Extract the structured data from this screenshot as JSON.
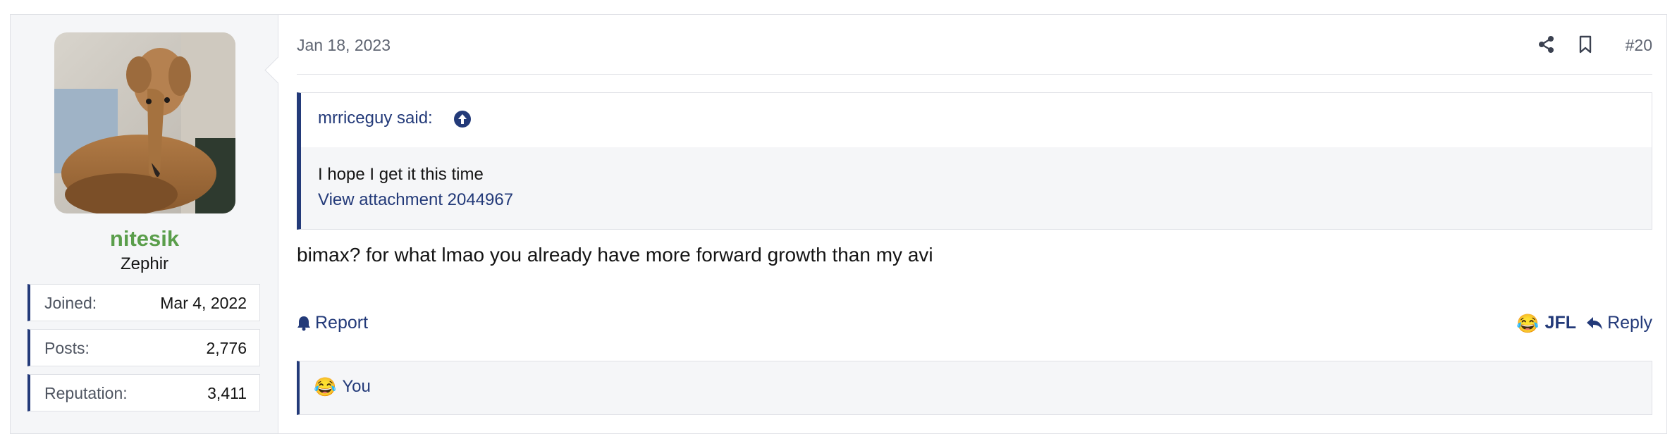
{
  "post": {
    "user": {
      "name": "nitesik",
      "title": "Zephir",
      "stats": [
        {
          "label": "Joined:",
          "value": "Mar 4, 2022"
        },
        {
          "label": "Posts:",
          "value": "2,776"
        },
        {
          "label": "Reputation:",
          "value": "3,411"
        }
      ]
    },
    "date": "Jan 18, 2023",
    "number": "#20",
    "quote": {
      "author": "mrriceguy said:",
      "text": "I hope I get it this time",
      "attachment": "View attachment 2044967"
    },
    "body": "bimax? for what lmao you already have more forward growth than my avi",
    "actions": {
      "report": "Report",
      "reaction": "JFL",
      "reply": "Reply"
    },
    "reactions_summary": "You",
    "colors": {
      "accent": "#233a79",
      "username": "#5a9e4b"
    },
    "icons": [
      "share-icon",
      "bookmark-icon",
      "arrow-up-circle-icon",
      "bell-icon",
      "laugh-cry-emoji",
      "reply-icon"
    ]
  }
}
